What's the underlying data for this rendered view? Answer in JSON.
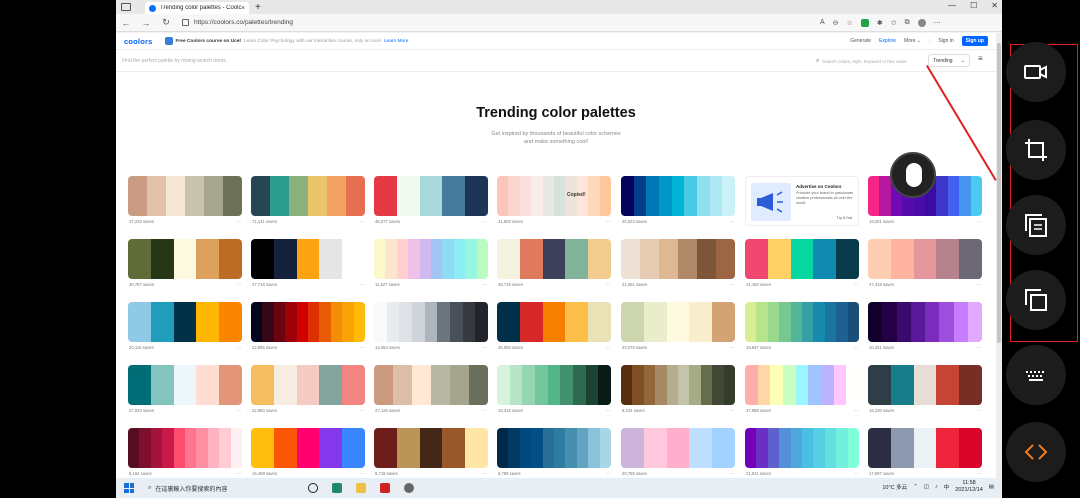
{
  "browser": {
    "tab_title": "Trending color palettes - Coolors",
    "url": "https://coolors.co/palettes/trending"
  },
  "site": {
    "logo": "coolors",
    "promo_title": "Free Coolors course on Ucel",
    "promo_text": "Learn Color Psychology with our interactive course, only on Ucel",
    "promo_link": "Learn More",
    "nav": [
      "Generate",
      "Explore",
      "More",
      "Sign in"
    ],
    "signup": "Sign up",
    "search_hint": "Find the perfect palette by mixing search terms.",
    "search_placeholder": "Search colors, style, keyword or hex value",
    "sort_value": "Trending"
  },
  "hero": {
    "title": "Trending color palettes",
    "subtitle": "Get inspired by thousands of beautiful color schemes and make something cool!"
  },
  "ad": {
    "head": "Advertise on Coolors",
    "body": "Promote your brand to passionate creative professionals all over the world.",
    "cta": "Try it Out"
  },
  "copied_label": "Copied!",
  "palettes": [
    {
      "saves": "47,232 saves",
      "colors": [
        "#cb9c84",
        "#e3c2ac",
        "#f6e6d6",
        "#c8c3ae",
        "#a4a690",
        "#6d7158"
      ]
    },
    {
      "saves": "71,141 saves",
      "colors": [
        "#264653",
        "#2a9d8f",
        "#8ab17d",
        "#e9c46a",
        "#f4a261",
        "#e76f51"
      ]
    },
    {
      "saves": "46,077 saves",
      "colors": [
        "#e63946",
        "#f1faee",
        "#a8dadc",
        "#457b9d",
        "#1d3557"
      ]
    },
    {
      "saves": "41,800 saves",
      "colors": [
        "#fec5bb",
        "#fcd5ce",
        "#fae1dd",
        "#f8edeb",
        "#e8e8e4",
        "#d8e2dc",
        "#ece4db",
        "#ffe5d9",
        "#ffd7ba",
        "#fec89a"
      ]
    },
    {
      "saves": "20,523 saves",
      "colors": [
        "#03045e",
        "#023e8a",
        "#0077b6",
        "#0096c7",
        "#00b4d8",
        "#48cae4",
        "#90e0ef",
        "#ade8f4",
        "#caf0f8"
      ]
    },
    {
      "saves": "18,201 saves",
      "colors": [
        "#f72585",
        "#b5179e",
        "#7209b7",
        "#560bad",
        "#480ca8",
        "#3a0ca3",
        "#3f37c9",
        "#4361ee",
        "#4895ef",
        "#4cc9f0"
      ]
    },
    {
      "saves": "30,767 saves",
      "colors": [
        "#606c38",
        "#283618",
        "#fefae0",
        "#dda15e",
        "#bc6c25"
      ]
    },
    {
      "saves": "27,718 saves",
      "colors": [
        "#000000",
        "#14213d",
        "#fca311",
        "#e5e5e5",
        "#ffffff"
      ]
    },
    {
      "saves": "11,527 saves",
      "colors": [
        "#fbf8cc",
        "#fde4cf",
        "#ffcfd2",
        "#f1c0e8",
        "#cfbaf0",
        "#a3c4f3",
        "#90dbf4",
        "#8eecf5",
        "#98f5e1",
        "#b9fbc0"
      ]
    },
    {
      "saves": "28,716 saves",
      "colors": [
        "#f4f1de",
        "#e07a5f",
        "#3d405b",
        "#81b29a",
        "#f2cc8f"
      ]
    },
    {
      "saves": "21,061 saves",
      "colors": [
        "#ede0d4",
        "#e6ccb2",
        "#ddb892",
        "#b08968",
        "#7f5539",
        "#9c6644"
      ]
    },
    {
      "saves": "21,150 saves",
      "colors": [
        "#ef476f",
        "#ffd166",
        "#06d6a0",
        "#118ab2",
        "#073b4c"
      ]
    },
    {
      "saves": "47,418 saves",
      "colors": [
        "#ffcdb2",
        "#ffb4a2",
        "#e5989b",
        "#b5838d",
        "#6d6875"
      ]
    },
    {
      "saves": "20,115 saves",
      "colors": [
        "#8ecae6",
        "#219ebc",
        "#023047",
        "#ffb703",
        "#fb8500"
      ]
    },
    {
      "saves": "22,895 saves",
      "colors": [
        "#03071e",
        "#370617",
        "#6a040f",
        "#9d0208",
        "#d00000",
        "#dc2f02",
        "#e85d04",
        "#f48c06",
        "#faa307",
        "#ffba08"
      ]
    },
    {
      "saves": "14,053 saves",
      "colors": [
        "#f8f9fa",
        "#e9ecef",
        "#dee2e6",
        "#ced4da",
        "#adb5bd",
        "#6c757d",
        "#495057",
        "#343a40",
        "#212529"
      ]
    },
    {
      "saves": "26,050 saves",
      "colors": [
        "#003049",
        "#d62828",
        "#f77f00",
        "#fcbf49",
        "#eae2b7"
      ]
    },
    {
      "saves": "23,070 saves",
      "colors": [
        "#ccd5ae",
        "#e9edc9",
        "#fefae0",
        "#faedcd",
        "#d4a373"
      ]
    },
    {
      "saves": "19,947 saves",
      "colors": [
        "#d9ed92",
        "#b5e48c",
        "#99d98c",
        "#76c893",
        "#52b69a",
        "#34a0a4",
        "#168aad",
        "#1a759f",
        "#1e6091",
        "#184e77"
      ]
    },
    {
      "saves": "10,331 saves",
      "colors": [
        "#10002b",
        "#240046",
        "#3c096c",
        "#5a189a",
        "#7b2cbf",
        "#9d4edd",
        "#c77dff",
        "#e0aaff"
      ]
    },
    {
      "saves": "27,923 saves",
      "colors": [
        "#006d77",
        "#83c5be",
        "#edf6f9",
        "#ffddd2",
        "#e29578"
      ]
    },
    {
      "saves": "22,860 saves",
      "colors": [
        "#f6bd60",
        "#f7ede2",
        "#f5cac3",
        "#84a59d",
        "#f28482"
      ]
    },
    {
      "saves": "27,126 saves",
      "colors": [
        "#cb997e",
        "#ddbea9",
        "#ffe8d6",
        "#b7b7a4",
        "#a5a58d",
        "#6b705c"
      ]
    },
    {
      "saves": "18,316 saves",
      "colors": [
        "#d8f3dc",
        "#b7e4c7",
        "#95d5b2",
        "#74c69d",
        "#52b788",
        "#40916c",
        "#2d6a4f",
        "#1b4332",
        "#081c15"
      ]
    },
    {
      "saves": "8,224 saves",
      "colors": [
        "#582f0e",
        "#7f4f24",
        "#936639",
        "#a68a64",
        "#b6ad90",
        "#c2c5aa",
        "#a4ac86",
        "#656d4a",
        "#414833",
        "#333d29"
      ]
    },
    {
      "saves": "37,888 saves",
      "colors": [
        "#ffadad",
        "#ffd6a5",
        "#fdffb6",
        "#caffbf",
        "#9bf6ff",
        "#a0c4ff",
        "#bdb2ff",
        "#ffc6ff",
        "#fffffc"
      ]
    },
    {
      "saves": "15,230 saves",
      "colors": [
        "#2f3e46",
        "#177e89",
        "#e6ddd4",
        "#c44536",
        "#772e25"
      ]
    },
    {
      "saves": "5,164 saves",
      "colors": [
        "#590d22",
        "#800f2f",
        "#a4133c",
        "#c9184a",
        "#ff4d6d",
        "#ff758f",
        "#ff8fa3",
        "#ffb3c1",
        "#ffccd5",
        "#fff0f3"
      ]
    },
    {
      "saves": "16,408 saves",
      "colors": [
        "#ffbe0b",
        "#fb5607",
        "#ff006e",
        "#8338ec",
        "#3a86ff"
      ]
    },
    {
      "saves": "8,718 saves",
      "colors": [
        "#6f1d1b",
        "#bb9457",
        "#432818",
        "#99582a",
        "#ffe6a7"
      ]
    },
    {
      "saves": "9,789 saves",
      "colors": [
        "#012a4a",
        "#013a63",
        "#01497c",
        "#014f86",
        "#2a6f97",
        "#2c7da0",
        "#468faf",
        "#61a5c2",
        "#89c2d9",
        "#a9d6e5"
      ]
    },
    {
      "saves": "20,765 saves",
      "colors": [
        "#cdb4db",
        "#ffc8dd",
        "#ffafcc",
        "#bde0fe",
        "#a2d2ff"
      ]
    },
    {
      "saves": "21,041 saves",
      "colors": [
        "#7400b8",
        "#6930c3",
        "#5e60ce",
        "#5390d9",
        "#4ea8de",
        "#48bfe3",
        "#56cfe1",
        "#64dfdf",
        "#72efdd",
        "#80ffdb"
      ]
    },
    {
      "saves": "17,697 saves",
      "colors": [
        "#2b2d42",
        "#8d99ae",
        "#edf2f4",
        "#ef233c",
        "#d90429"
      ]
    }
  ],
  "taskbar": {
    "search_text": "在這裏輸入你要搜索的內容",
    "weather": "10°C 多云",
    "ime": "中",
    "time": "11:58",
    "date": "2021/12/14"
  }
}
